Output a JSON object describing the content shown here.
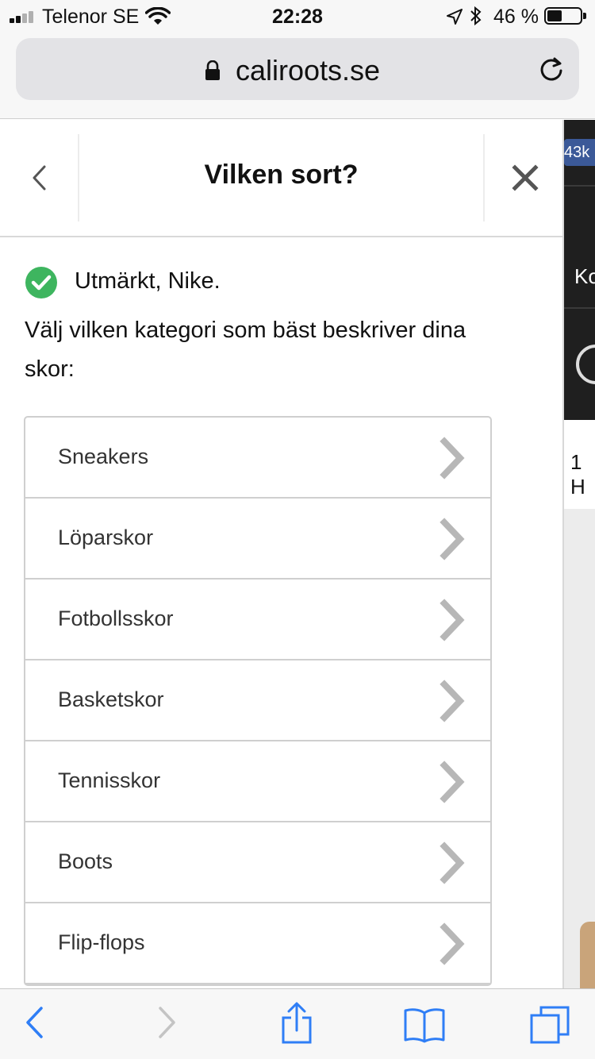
{
  "status_bar": {
    "carrier": "Telenor SE",
    "time": "22:28",
    "battery_percent": "46 %",
    "battery_level": 0.46
  },
  "browser": {
    "url": "caliroots.se"
  },
  "background_page": {
    "badge": "43k",
    "menu_text": "Ko",
    "line_text": "1 H"
  },
  "modal": {
    "title": "Vilken sort?",
    "confirmation": "Utmärkt, Nike.",
    "prompt": "Välj vilken kategori som bäst beskriver dina skor:",
    "categories": [
      {
        "label": "Sneakers"
      },
      {
        "label": "Löparskor"
      },
      {
        "label": "Fotbollsskor"
      },
      {
        "label": "Basketskor"
      },
      {
        "label": "Tennisskor"
      },
      {
        "label": "Boots"
      },
      {
        "label": "Flip-flops"
      }
    ]
  },
  "colors": {
    "accent": "#2f7ef6",
    "success": "#3eb55f",
    "chevron": "#b7b7b7"
  }
}
